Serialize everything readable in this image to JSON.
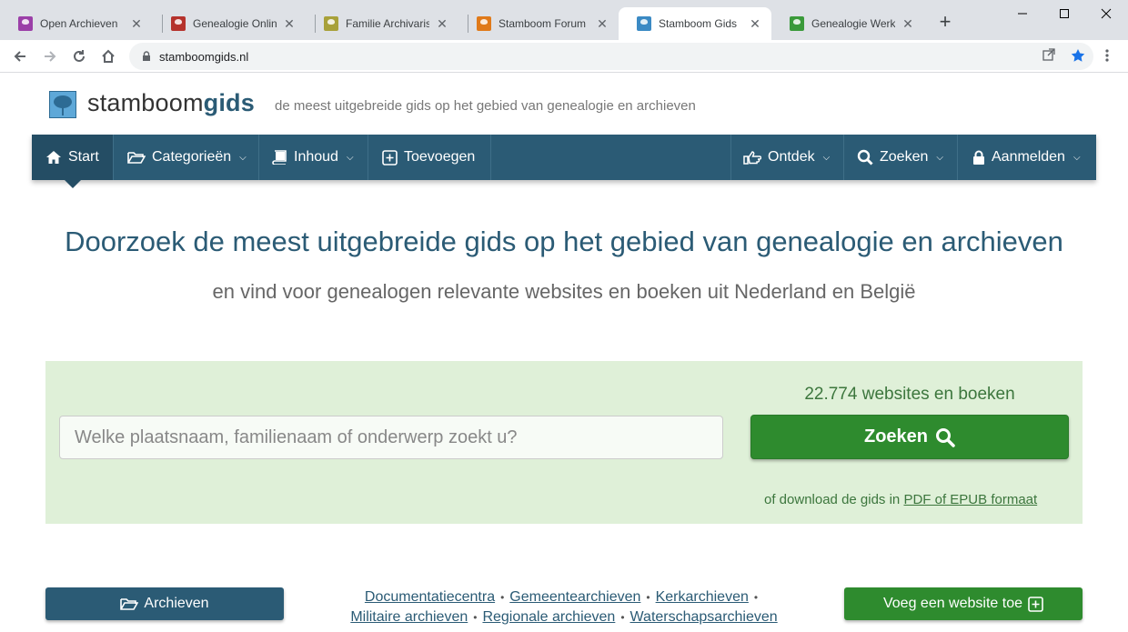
{
  "browser": {
    "tabs": [
      {
        "label": "Open Archieven",
        "color": "#9b3fa8"
      },
      {
        "label": "Genealogie Online",
        "color": "#b5322c"
      },
      {
        "label": "Familie Archivaris -",
        "color": "#a8a13a"
      },
      {
        "label": "Stamboom Forum",
        "color": "#e07a1a"
      },
      {
        "label": "Stamboom Gids",
        "color": "#3b8ac4"
      },
      {
        "label": "Genealogie Werkbalk",
        "color": "#3a9a3a"
      }
    ],
    "active_tab": 4,
    "url": "stamboomgids.nl"
  },
  "site": {
    "brand_light": "stamboom",
    "brand_bold": "gids",
    "tagline": "de meest uitgebreide gids op het gebied van genealogie en archieven",
    "nav": {
      "start": "Start",
      "categories": "Categorieën",
      "contents": "Inhoud",
      "add": "Toevoegen",
      "discover": "Ontdek",
      "search": "Zoeken",
      "login": "Aanmelden"
    },
    "hero": {
      "title": "Doorzoek de meest uitgebreide gids op het gebied van genealogie en archieven",
      "subtitle": "en vind voor genealogen relevante websites en boeken uit Nederland en België"
    },
    "search": {
      "placeholder": "Welke plaatsnaam, familienaam of onderwerp zoekt u?",
      "count": "22.774 websites en boeken",
      "button": "Zoeken",
      "download_prefix": "of download de gids in",
      "download_link": "PDF of EPUB formaat"
    },
    "footer": {
      "archives_button": "Archieven",
      "add_button": "Voeg een website toe",
      "links_row1": [
        "Documentatiecentra",
        "Gemeentearchieven",
        "Kerkarchieven"
      ],
      "links_row2": [
        "Militaire archieven",
        "Regionale archieven",
        "Waterschapsarchieven"
      ]
    },
    "colors": {
      "primary": "#2b5b75",
      "success": "#2e8b2e",
      "panel": "#dff0d8"
    }
  }
}
